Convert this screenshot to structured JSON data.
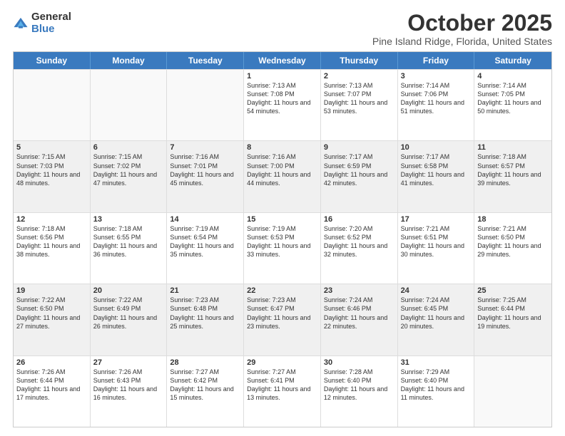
{
  "logo": {
    "general": "General",
    "blue": "Blue"
  },
  "header": {
    "month": "October 2025",
    "location": "Pine Island Ridge, Florida, United States"
  },
  "weekdays": [
    "Sunday",
    "Monday",
    "Tuesday",
    "Wednesday",
    "Thursday",
    "Friday",
    "Saturday"
  ],
  "rows": [
    [
      {
        "day": "",
        "sunrise": "",
        "sunset": "",
        "daylight": "",
        "empty": true
      },
      {
        "day": "",
        "sunrise": "",
        "sunset": "",
        "daylight": "",
        "empty": true
      },
      {
        "day": "",
        "sunrise": "",
        "sunset": "",
        "daylight": "",
        "empty": true
      },
      {
        "day": "1",
        "sunrise": "Sunrise: 7:13 AM",
        "sunset": "Sunset: 7:08 PM",
        "daylight": "Daylight: 11 hours and 54 minutes."
      },
      {
        "day": "2",
        "sunrise": "Sunrise: 7:13 AM",
        "sunset": "Sunset: 7:07 PM",
        "daylight": "Daylight: 11 hours and 53 minutes."
      },
      {
        "day": "3",
        "sunrise": "Sunrise: 7:14 AM",
        "sunset": "Sunset: 7:06 PM",
        "daylight": "Daylight: 11 hours and 51 minutes."
      },
      {
        "day": "4",
        "sunrise": "Sunrise: 7:14 AM",
        "sunset": "Sunset: 7:05 PM",
        "daylight": "Daylight: 11 hours and 50 minutes."
      }
    ],
    [
      {
        "day": "5",
        "sunrise": "Sunrise: 7:15 AM",
        "sunset": "Sunset: 7:03 PM",
        "daylight": "Daylight: 11 hours and 48 minutes.",
        "shaded": true
      },
      {
        "day": "6",
        "sunrise": "Sunrise: 7:15 AM",
        "sunset": "Sunset: 7:02 PM",
        "daylight": "Daylight: 11 hours and 47 minutes.",
        "shaded": true
      },
      {
        "day": "7",
        "sunrise": "Sunrise: 7:16 AM",
        "sunset": "Sunset: 7:01 PM",
        "daylight": "Daylight: 11 hours and 45 minutes.",
        "shaded": true
      },
      {
        "day": "8",
        "sunrise": "Sunrise: 7:16 AM",
        "sunset": "Sunset: 7:00 PM",
        "daylight": "Daylight: 11 hours and 44 minutes.",
        "shaded": true
      },
      {
        "day": "9",
        "sunrise": "Sunrise: 7:17 AM",
        "sunset": "Sunset: 6:59 PM",
        "daylight": "Daylight: 11 hours and 42 minutes.",
        "shaded": true
      },
      {
        "day": "10",
        "sunrise": "Sunrise: 7:17 AM",
        "sunset": "Sunset: 6:58 PM",
        "daylight": "Daylight: 11 hours and 41 minutes.",
        "shaded": true
      },
      {
        "day": "11",
        "sunrise": "Sunrise: 7:18 AM",
        "sunset": "Sunset: 6:57 PM",
        "daylight": "Daylight: 11 hours and 39 minutes.",
        "shaded": true
      }
    ],
    [
      {
        "day": "12",
        "sunrise": "Sunrise: 7:18 AM",
        "sunset": "Sunset: 6:56 PM",
        "daylight": "Daylight: 11 hours and 38 minutes."
      },
      {
        "day": "13",
        "sunrise": "Sunrise: 7:18 AM",
        "sunset": "Sunset: 6:55 PM",
        "daylight": "Daylight: 11 hours and 36 minutes."
      },
      {
        "day": "14",
        "sunrise": "Sunrise: 7:19 AM",
        "sunset": "Sunset: 6:54 PM",
        "daylight": "Daylight: 11 hours and 35 minutes."
      },
      {
        "day": "15",
        "sunrise": "Sunrise: 7:19 AM",
        "sunset": "Sunset: 6:53 PM",
        "daylight": "Daylight: 11 hours and 33 minutes."
      },
      {
        "day": "16",
        "sunrise": "Sunrise: 7:20 AM",
        "sunset": "Sunset: 6:52 PM",
        "daylight": "Daylight: 11 hours and 32 minutes."
      },
      {
        "day": "17",
        "sunrise": "Sunrise: 7:21 AM",
        "sunset": "Sunset: 6:51 PM",
        "daylight": "Daylight: 11 hours and 30 minutes."
      },
      {
        "day": "18",
        "sunrise": "Sunrise: 7:21 AM",
        "sunset": "Sunset: 6:50 PM",
        "daylight": "Daylight: 11 hours and 29 minutes."
      }
    ],
    [
      {
        "day": "19",
        "sunrise": "Sunrise: 7:22 AM",
        "sunset": "Sunset: 6:50 PM",
        "daylight": "Daylight: 11 hours and 27 minutes.",
        "shaded": true
      },
      {
        "day": "20",
        "sunrise": "Sunrise: 7:22 AM",
        "sunset": "Sunset: 6:49 PM",
        "daylight": "Daylight: 11 hours and 26 minutes.",
        "shaded": true
      },
      {
        "day": "21",
        "sunrise": "Sunrise: 7:23 AM",
        "sunset": "Sunset: 6:48 PM",
        "daylight": "Daylight: 11 hours and 25 minutes.",
        "shaded": true
      },
      {
        "day": "22",
        "sunrise": "Sunrise: 7:23 AM",
        "sunset": "Sunset: 6:47 PM",
        "daylight": "Daylight: 11 hours and 23 minutes.",
        "shaded": true
      },
      {
        "day": "23",
        "sunrise": "Sunrise: 7:24 AM",
        "sunset": "Sunset: 6:46 PM",
        "daylight": "Daylight: 11 hours and 22 minutes.",
        "shaded": true
      },
      {
        "day": "24",
        "sunrise": "Sunrise: 7:24 AM",
        "sunset": "Sunset: 6:45 PM",
        "daylight": "Daylight: 11 hours and 20 minutes.",
        "shaded": true
      },
      {
        "day": "25",
        "sunrise": "Sunrise: 7:25 AM",
        "sunset": "Sunset: 6:44 PM",
        "daylight": "Daylight: 11 hours and 19 minutes.",
        "shaded": true
      }
    ],
    [
      {
        "day": "26",
        "sunrise": "Sunrise: 7:26 AM",
        "sunset": "Sunset: 6:44 PM",
        "daylight": "Daylight: 11 hours and 17 minutes."
      },
      {
        "day": "27",
        "sunrise": "Sunrise: 7:26 AM",
        "sunset": "Sunset: 6:43 PM",
        "daylight": "Daylight: 11 hours and 16 minutes."
      },
      {
        "day": "28",
        "sunrise": "Sunrise: 7:27 AM",
        "sunset": "Sunset: 6:42 PM",
        "daylight": "Daylight: 11 hours and 15 minutes."
      },
      {
        "day": "29",
        "sunrise": "Sunrise: 7:27 AM",
        "sunset": "Sunset: 6:41 PM",
        "daylight": "Daylight: 11 hours and 13 minutes."
      },
      {
        "day": "30",
        "sunrise": "Sunrise: 7:28 AM",
        "sunset": "Sunset: 6:40 PM",
        "daylight": "Daylight: 11 hours and 12 minutes."
      },
      {
        "day": "31",
        "sunrise": "Sunrise: 7:29 AM",
        "sunset": "Sunset: 6:40 PM",
        "daylight": "Daylight: 11 hours and 11 minutes."
      },
      {
        "day": "",
        "sunrise": "",
        "sunset": "",
        "daylight": "",
        "empty": true
      }
    ]
  ]
}
